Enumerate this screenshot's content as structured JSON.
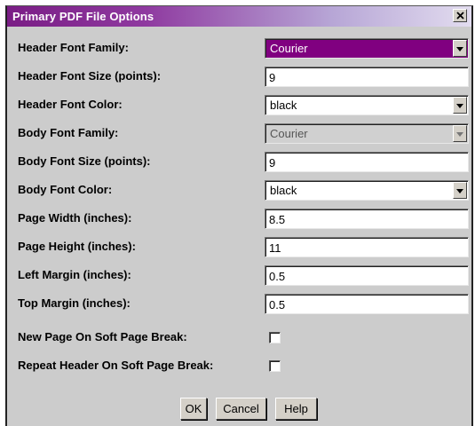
{
  "window": {
    "title": "Primary PDF File Options",
    "close_glyph": "×"
  },
  "colors": {
    "title_start": "#7a1d85",
    "title_end": "#e2dcef",
    "selected_field": "#800080",
    "dialog_bg": "#cccccc"
  },
  "fields": {
    "header_font_family": {
      "label": "Header Font Family:",
      "value": "Courier"
    },
    "header_font_size": {
      "label": "Header Font Size (points):",
      "value": "9"
    },
    "header_font_color": {
      "label": "Header Font Color:",
      "value": "black"
    },
    "body_font_family": {
      "label": "Body Font Family:",
      "value": "Courier"
    },
    "body_font_size": {
      "label": "Body Font Size (points):",
      "value": "9"
    },
    "body_font_color": {
      "label": "Body Font Color:",
      "value": "black"
    },
    "page_width": {
      "label": "Page Width (inches):",
      "value": "8.5"
    },
    "page_height": {
      "label": "Page Height (inches):",
      "value": "11"
    },
    "left_margin": {
      "label": "Left Margin (inches):",
      "value": "0.5"
    },
    "top_margin": {
      "label": "Top Margin (inches):",
      "value": "0.5"
    },
    "new_page_soft_break": {
      "label": "New Page On Soft Page Break:",
      "checked": false
    },
    "repeat_header_soft_break": {
      "label": "Repeat Header On Soft Page Break:",
      "checked": false
    }
  },
  "buttons": {
    "ok": "OK",
    "cancel": "Cancel",
    "help": "Help"
  }
}
